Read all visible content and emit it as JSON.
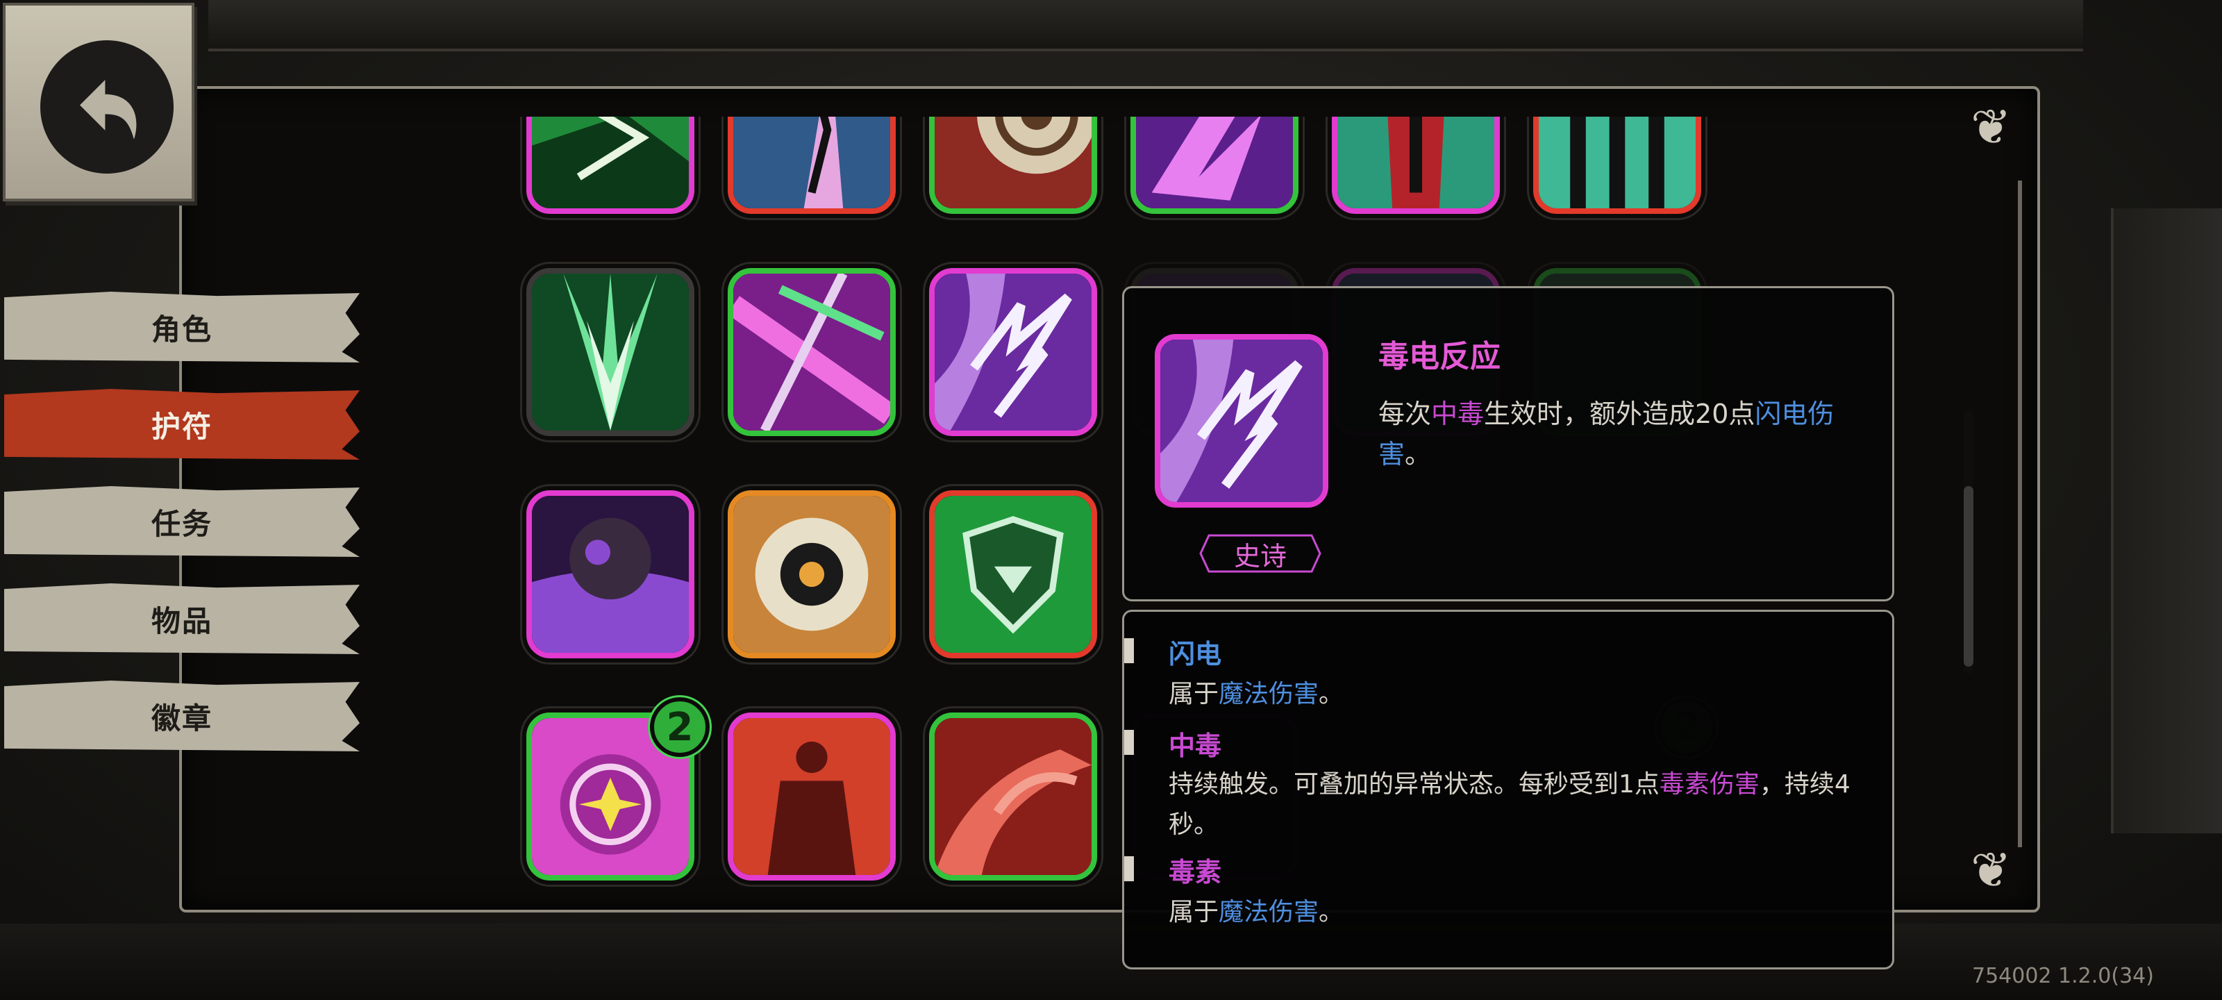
{
  "nav": {
    "items": [
      {
        "label": "角色",
        "active": false
      },
      {
        "label": "护符",
        "active": true
      },
      {
        "label": "任务",
        "active": false
      },
      {
        "label": "物品",
        "active": false
      },
      {
        "label": "徽章",
        "active": false
      }
    ]
  },
  "grid": {
    "badge_counts": [
      "2",
      "2"
    ]
  },
  "popup": {
    "title": "毒电反应",
    "desc_parts": [
      "每次",
      "中毒",
      "生效时，额外造成20点",
      "闪电伤害",
      "。"
    ],
    "rarity": "史诗"
  },
  "glossary": {
    "entries": [
      {
        "term": "闪电",
        "text_parts": [
          "属于",
          "魔法伤害",
          "。"
        ]
      },
      {
        "term": "中毒",
        "text_parts": [
          "持续触发。可叠加的异常状态。每秒受到1点",
          "毒素伤害",
          "，持续4秒。"
        ]
      },
      {
        "term": "毒素",
        "text_parts": [
          "属于",
          "魔法伤害",
          "。"
        ]
      }
    ]
  },
  "version": "754002 1.2.0(34)",
  "colors": {
    "active_tab": "#b2381e",
    "epic_purple": "#e23bd0",
    "rare_green": "#34c33c",
    "legend_red": "#e33a2b",
    "highlight_blue": "#4e8fe0"
  }
}
